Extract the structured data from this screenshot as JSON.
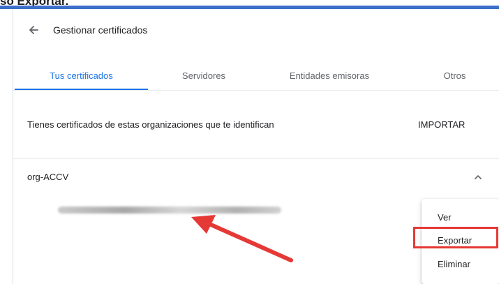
{
  "caption": {
    "text": "so Exportar."
  },
  "header": {
    "title": "Gestionar certificados",
    "back_icon": "arrow-left-icon"
  },
  "tabs": [
    {
      "label": "Tus certificados",
      "active": true
    },
    {
      "label": "Servidores",
      "active": false
    },
    {
      "label": "Entidades emisoras",
      "active": false
    },
    {
      "label": "Otros",
      "active": false
    }
  ],
  "import_row": {
    "description": "Tienes certificados de estas organizaciones que te identifican",
    "button": "IMPORTAR"
  },
  "organization": {
    "name": "org-ACCV",
    "expand_icon": "chevron-up-icon"
  },
  "context_menu": {
    "items": [
      "Ver",
      "Exportar",
      "Eliminar"
    ]
  },
  "annotation": {
    "color": "#e53935",
    "highlighted_item": "Exportar"
  },
  "colors": {
    "accent": "#1a73e8",
    "rule": "#3e6fcb"
  }
}
